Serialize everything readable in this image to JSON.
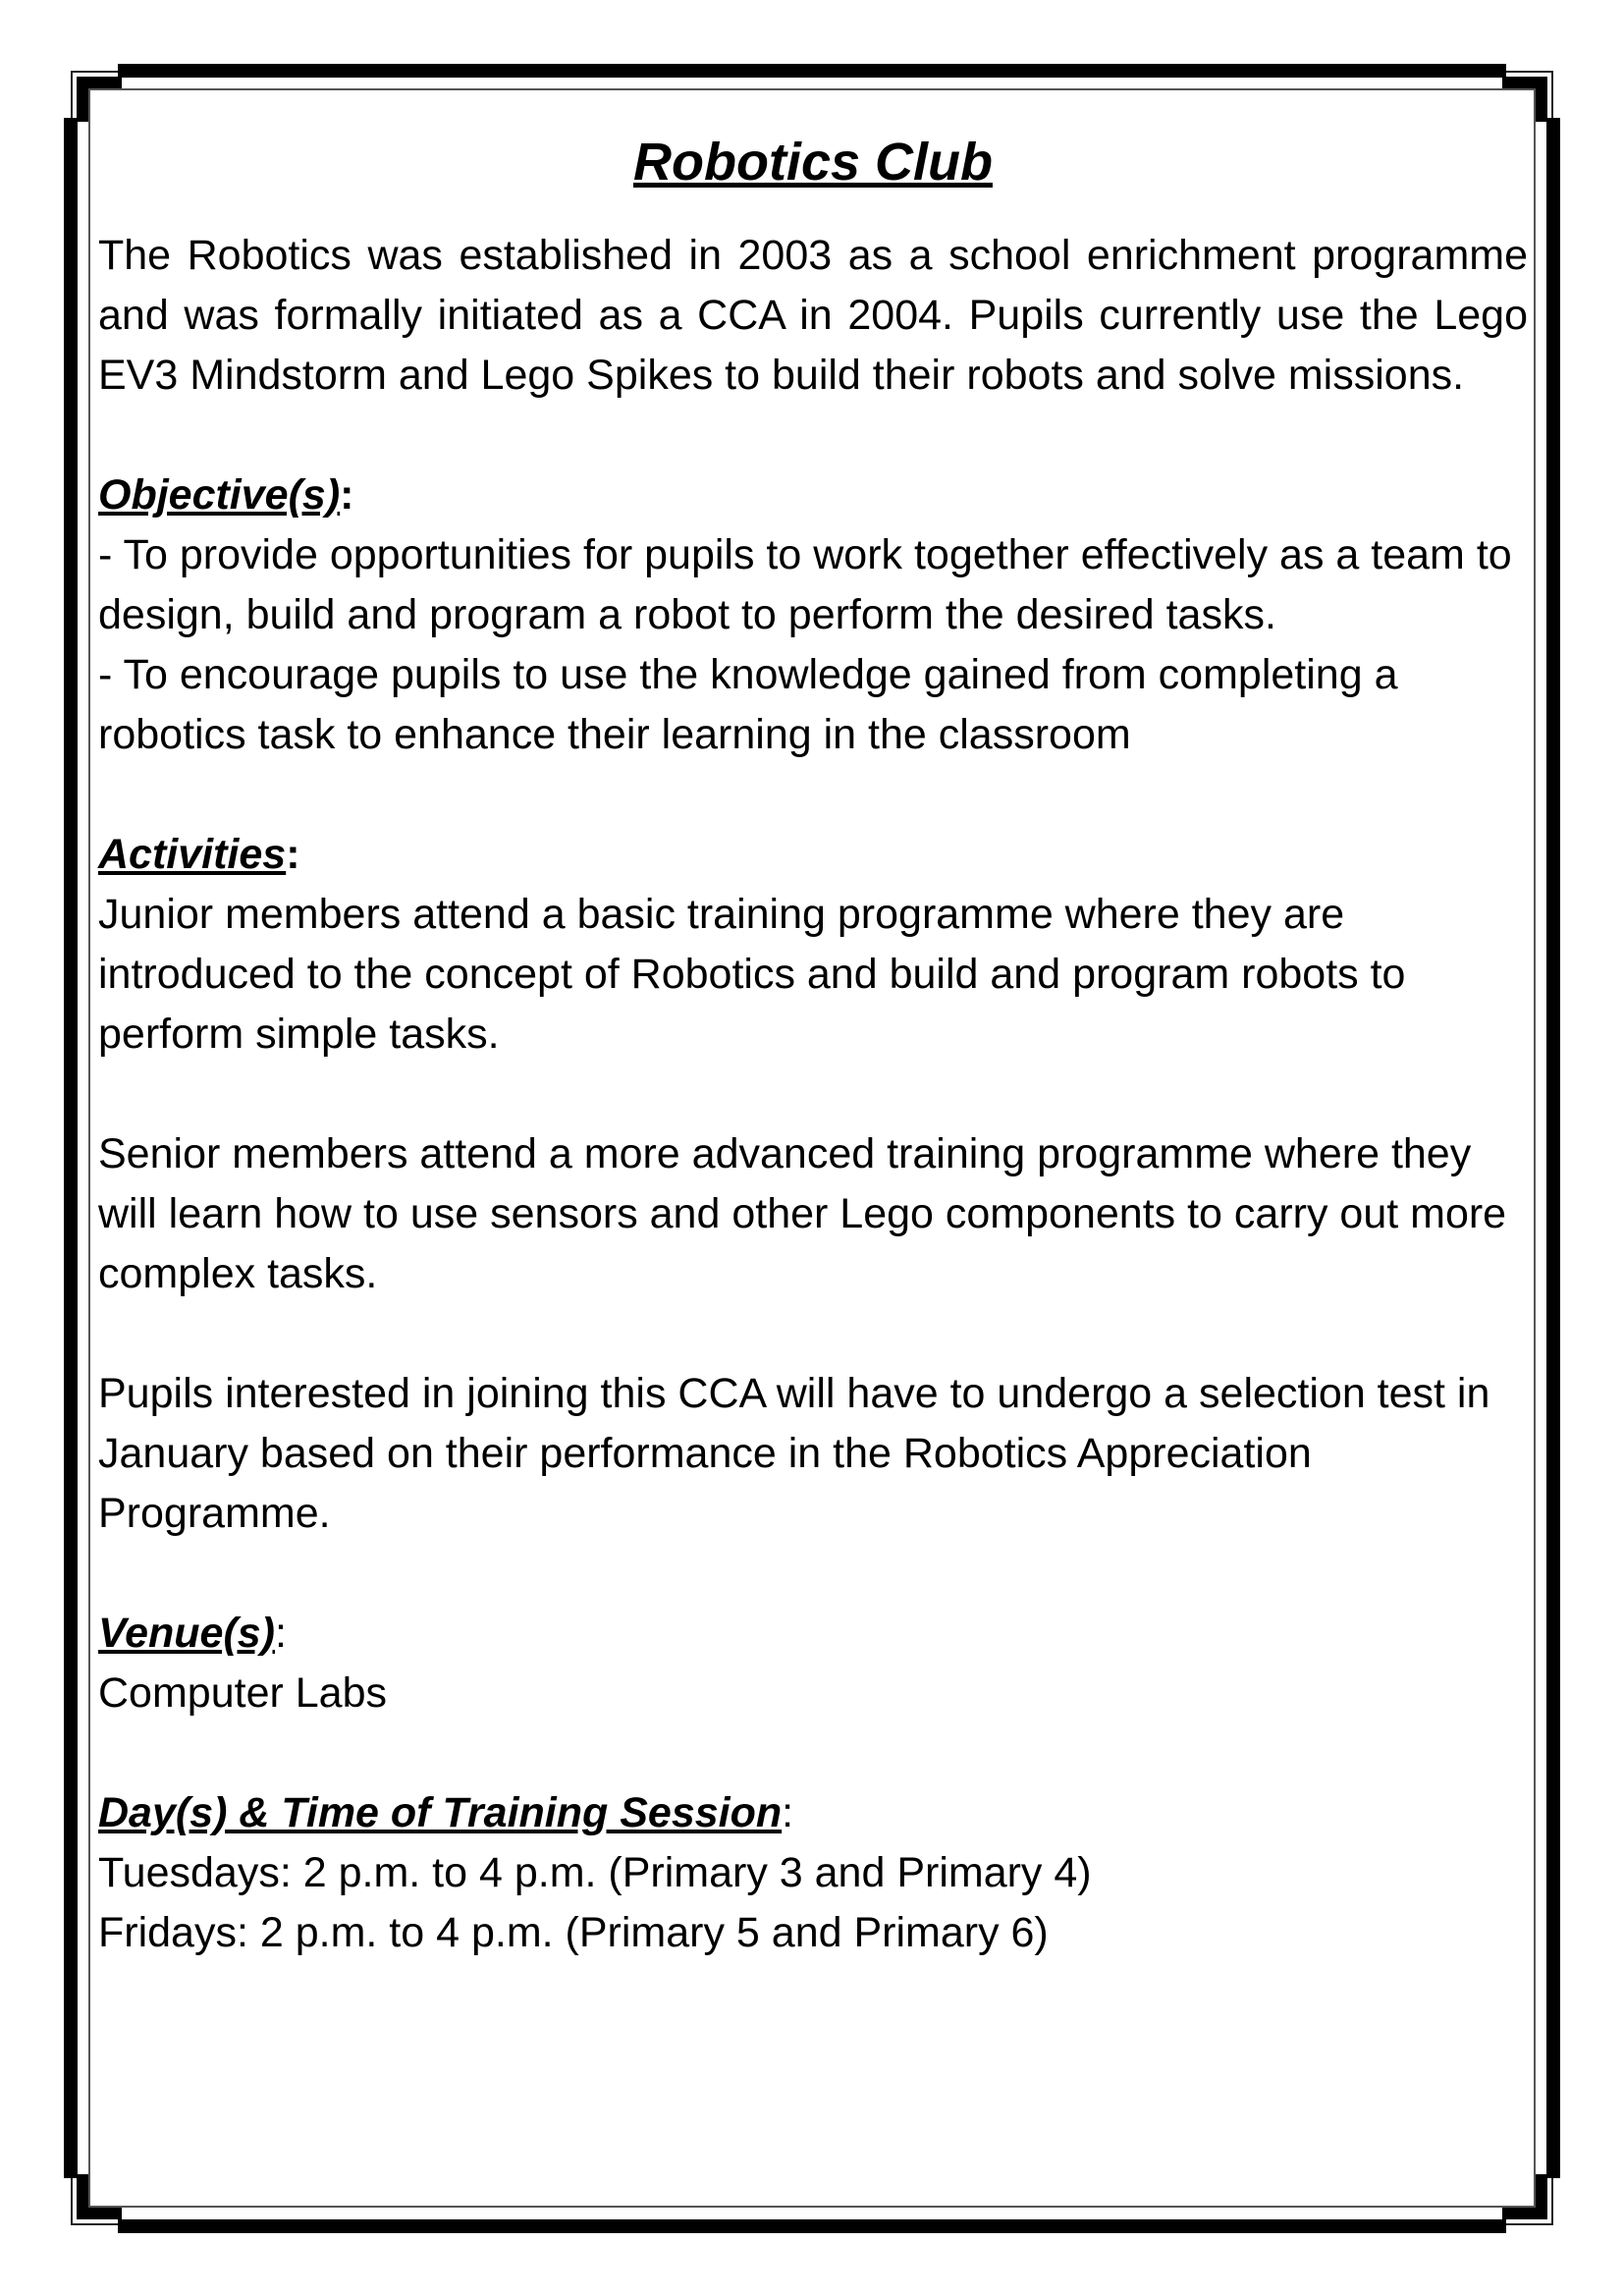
{
  "document": {
    "title": "Robotics Club",
    "intro": "The Robotics was established in 2003 as a school enrichment programme and was formally initiated as a CCA in 2004. Pupils currently use the Lego EV3 Mindstorm and Lego Spikes to build their robots and solve missions.",
    "objectives": {
      "heading": "Objective(s)",
      "colon": ":",
      "items": [
        "- To provide opportunities for pupils to work together effectively as a team to design, build and program a robot to perform the desired tasks.",
        "- To encourage pupils to use the knowledge gained from completing a robotics task to enhance their learning in the classroom"
      ]
    },
    "activities": {
      "heading": "Activities",
      "colon": ":",
      "paragraphs": [
        "Junior members attend a basic training programme where they are introduced to the concept of Robotics and build and program robots to perform simple tasks.",
        "Senior members attend a more advanced training programme where they will learn how to use sensors and other Lego components to carry out more complex tasks.",
        "Pupils interested in joining this CCA will have to undergo a selection test in January based on their performance in the Robotics Appreciation Programme."
      ]
    },
    "venue": {
      "heading": "Venue(s)",
      "colon": ":",
      "value": "Computer Labs"
    },
    "schedule": {
      "heading": "Day(s) & Time of Training Session",
      "colon": ":",
      "lines": [
        "Tuesdays: 2 p.m. to 4 p.m. (Primary 3 and Primary 4)",
        "Fridays: 2 p.m. to 4 p.m. (Primary 5 and Primary 6)"
      ]
    }
  }
}
